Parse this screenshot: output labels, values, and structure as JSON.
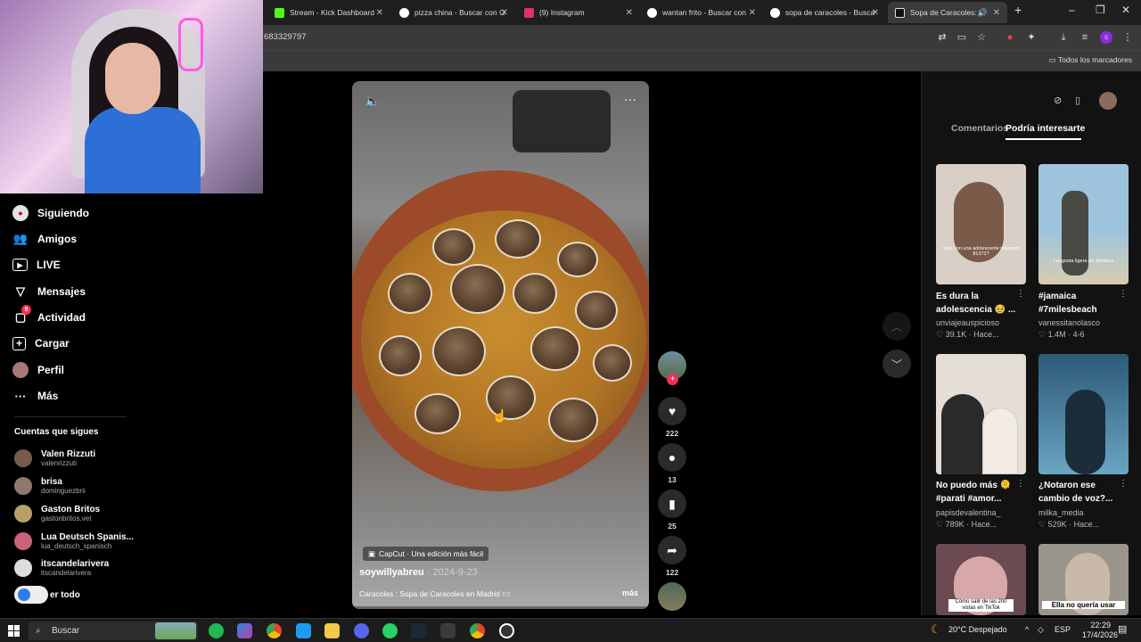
{
  "browser": {
    "tabs": [
      {
        "title": "Stream - Kick Dashboard",
        "color": "#53fc18"
      },
      {
        "title": "pizza china - Buscar con G",
        "color": "#ffffff"
      },
      {
        "title": "(9) Instagram",
        "color": "#e1306c"
      },
      {
        "title": "wantan frito - Buscar con",
        "color": "#ffffff"
      },
      {
        "title": "sopa de caracoles - Busca",
        "color": "#ffffff"
      },
      {
        "title": "Sopa de Caracoles: Un",
        "color": "#111111"
      }
    ],
    "new_tab": "+",
    "window_controls": [
      "–",
      "❐",
      "✕"
    ],
    "address": "683329797",
    "bookmarks_all": "Todos los marcadores"
  },
  "sidebar": {
    "items": [
      {
        "label": "Siguiendo",
        "icon": "following-icon"
      },
      {
        "label": "Amigos",
        "icon": "friends-icon"
      },
      {
        "label": "LIVE",
        "icon": "live-icon"
      },
      {
        "label": "Mensajes",
        "icon": "messages-icon"
      },
      {
        "label": "Actividad",
        "icon": "activity-icon",
        "badge": "9"
      },
      {
        "label": "Cargar",
        "icon": "upload-icon"
      },
      {
        "label": "Perfil",
        "icon": "profile-icon"
      },
      {
        "label": "Más",
        "icon": "more-icon"
      }
    ],
    "following_header": "Cuentas que sigues",
    "accounts": [
      {
        "name": "Valen Rizzuti",
        "handle": "valenrizzuti"
      },
      {
        "name": "brisa",
        "handle": "dominguezbrii"
      },
      {
        "name": "Gaston Britos",
        "handle": "gastonbritos.vet"
      },
      {
        "name": "Lua Deutsch Spanis...",
        "handle": "lua_deutsch_spanisch"
      },
      {
        "name": "itscandelarivera",
        "handle": "itscandelarivera"
      }
    ],
    "see_all": "er todo"
  },
  "video": {
    "capcut": "CapCut · Una edición más fácil",
    "author": "soywillyabreu",
    "date": " · 2024-9-23",
    "description": "Caracoles : Sopa de Caracoles en Madrid",
    "desc_tag": "ES",
    "more": "más",
    "likes": "222",
    "comments": "13",
    "saves": "25",
    "shares": "122"
  },
  "right_panel": {
    "tab_comments": "Comentarios",
    "tab_interest": "Podría interesarte",
    "items": [
      {
        "title": "Es dura la adolescencia 🥹 ...",
        "user": "unviajeauspicioso",
        "stat": "♡ 39.1K · Hace...",
        "bg": "#d9cfc6",
        "caption": "Vivir con una adolescente volumen 81372?"
      },
      {
        "title": "#jamaica #7milesbeach",
        "user": "vanessitanolasco",
        "stat": "♡ 1.4M · 4-6",
        "bg": "#8fb4c9",
        "caption": "Langosta ligera en Jamaica"
      },
      {
        "title": "No puedo más 🫠 #parati #amor...",
        "user": "papisdevalentina_",
        "stat": "♡ 789K · Hace...",
        "bg": "#e4ded6",
        "caption": ""
      },
      {
        "title": "¿Notaron ese cambio de voz?...",
        "user": "milka_media",
        "stat": "♡ 529K · Hace...",
        "bg": "#3b6f8f",
        "caption": ""
      },
      {
        "title": "",
        "user": "",
        "stat": "",
        "bg": "#6b4a52",
        "caption": "Cómo salir de las 200 vistas en TikTok"
      },
      {
        "title": "",
        "user": "",
        "stat": "",
        "bg": "#9a958d",
        "caption": "Ella no quería usar"
      }
    ]
  },
  "taskbar": {
    "search": "Buscar",
    "weather": "20°C Despejado",
    "lang": "ESP",
    "time": "22:29",
    "date": "17/4/2026"
  }
}
